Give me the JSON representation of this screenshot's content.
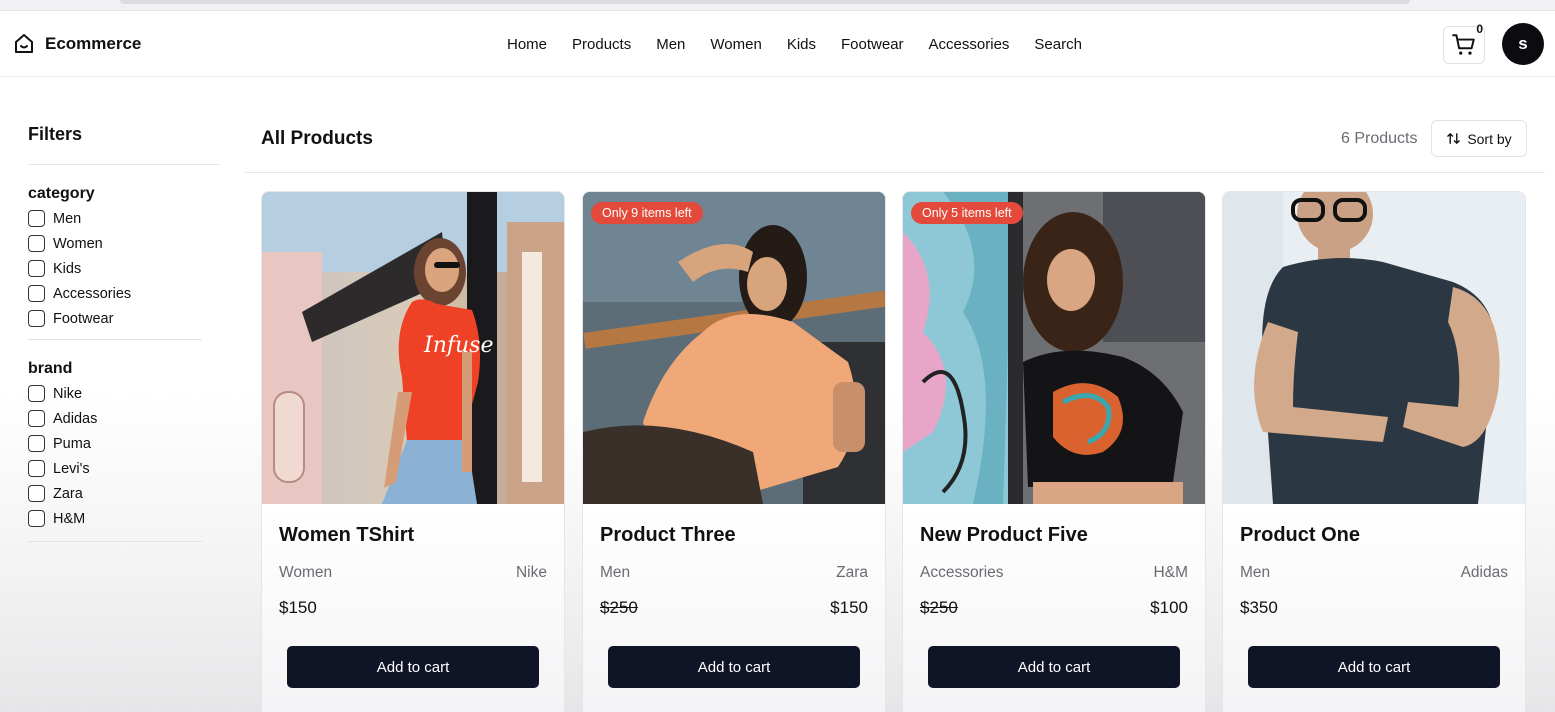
{
  "header": {
    "brand": "Ecommerce",
    "nav": [
      "Home",
      "Products",
      "Men",
      "Women",
      "Kids",
      "Footwear",
      "Accessories",
      "Search"
    ],
    "cart_count": "0",
    "avatar_letter": "s"
  },
  "sidebar": {
    "title": "Filters",
    "category_title": "category",
    "categories": [
      "Men",
      "Women",
      "Kids",
      "Accessories",
      "Footwear"
    ],
    "brand_title": "brand",
    "brands": [
      "Nike",
      "Adidas",
      "Puma",
      "Levi's",
      "Zara",
      "H&M"
    ]
  },
  "main": {
    "title": "All Products",
    "count": "6 Products",
    "sort_label": "Sort by"
  },
  "products": [
    {
      "name": "Women TShirt",
      "category": "Women",
      "brand": "Nike",
      "price": "$150",
      "sale_price": "",
      "badge": "",
      "button": "Add to cart"
    },
    {
      "name": "Product Three",
      "category": "Men",
      "brand": "Zara",
      "price": "$250",
      "sale_price": "$150",
      "badge": "Only 9 items left",
      "button": "Add to cart"
    },
    {
      "name": "New Product Five",
      "category": "Accessories",
      "brand": "H&M",
      "price": "$250",
      "sale_price": "$100",
      "badge": "Only 5 items left",
      "button": "Add to cart"
    },
    {
      "name": "Product One",
      "category": "Men",
      "brand": "Adidas",
      "price": "$350",
      "sale_price": "",
      "badge": "",
      "button": "Add to cart"
    }
  ],
  "colors": {
    "button_bg": "#0f1426",
    "badge_bg": "#e34a3c",
    "muted_text": "#6b6b72"
  }
}
